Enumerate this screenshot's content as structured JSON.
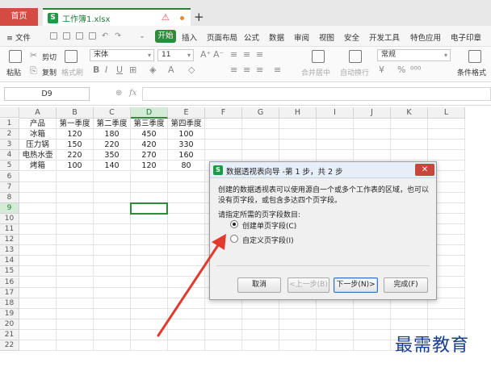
{
  "titlebar": {
    "home_tab": "首页",
    "file_tab": "工作簿1.xlsx",
    "file_icon_letter": "S",
    "new_tab": "+"
  },
  "menubar": {
    "file_menu": "≡ 文件",
    "start": "开始",
    "items": [
      "插入",
      "页面布局",
      "公式",
      "数据",
      "审阅",
      "视图",
      "安全",
      "开发工具",
      "特色应用",
      "电子印章"
    ]
  },
  "ribbon": {
    "cut": "剪切",
    "copy": "复制",
    "paste": "粘贴",
    "format_painter": "格式刷",
    "font_name": "宋体",
    "font_size": "11",
    "merge_center": "合并居中",
    "auto_wrap": "自动换行",
    "number_format": "常规",
    "conditional_format": "条件格式"
  },
  "formulabar": {
    "namebox": "D9",
    "fx": "fx"
  },
  "sheet": {
    "columns": [
      "A",
      "B",
      "C",
      "D",
      "E",
      "F",
      "G",
      "H",
      "I",
      "J",
      "K",
      "L"
    ],
    "rows": [
      "1",
      "2",
      "3",
      "4",
      "5",
      "6",
      "7",
      "8",
      "9",
      "10",
      "11",
      "12",
      "13",
      "14",
      "15",
      "16",
      "17",
      "18",
      "19",
      "20",
      "21",
      "22"
    ],
    "data": [
      [
        "产品",
        "第一季度",
        "第二季度",
        "第三季度",
        "第四季度"
      ],
      [
        "冰箱",
        "120",
        "180",
        "450",
        "100"
      ],
      [
        "压力锅",
        "150",
        "220",
        "420",
        "330"
      ],
      [
        "电热水壶",
        "220",
        "350",
        "270",
        "160"
      ],
      [
        "烤箱",
        "100",
        "140",
        "120",
        "80"
      ]
    ],
    "selected_cell": "D9"
  },
  "dialog": {
    "title": "数据透视表向导 -第 1 步，共 2 步",
    "close": "✕",
    "description": "创建的数据透视表可以使用源自一个或多个工作表的区域，也可以没有页字段，或包含多达四个页字段。",
    "prompt": "请指定所需的页字段数目:",
    "options": [
      {
        "label": "创建单页字段(C)",
        "selected": true
      },
      {
        "label": "自定义页字段(I)",
        "selected": false
      }
    ],
    "buttons": {
      "cancel": "取消",
      "back": "<上一步(B)",
      "next": "下一步(N)>",
      "finish": "完成(F)"
    }
  },
  "watermark": "最需教育",
  "colors": {
    "accent_green": "#2e8b3c",
    "home_tab_red": "#d44b43",
    "arrow_red": "#e23b2e",
    "watermark_blue": "#1b3f8f"
  }
}
